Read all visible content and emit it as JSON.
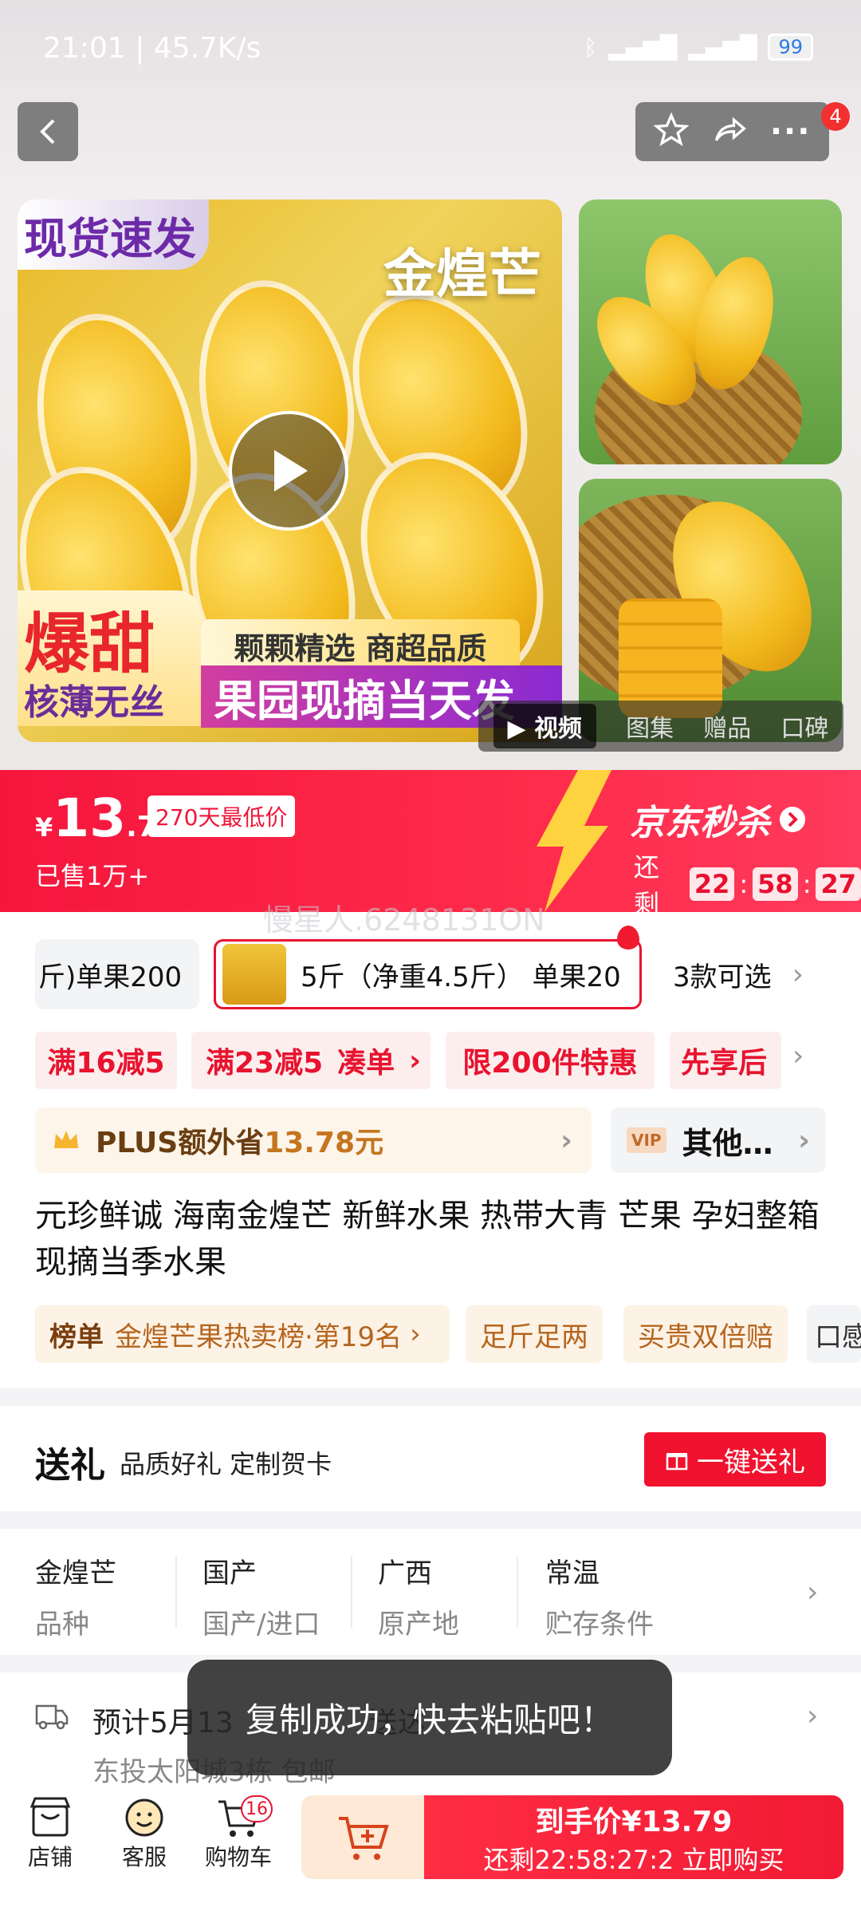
{
  "status_bar": {
    "time": "21:01 | 45.7K/s",
    "battery": "99"
  },
  "header": {
    "notification_count": "4"
  },
  "gallery": {
    "tag_top_left": "现货速发",
    "image_title": "金煌芒",
    "burst_title": "爆甜",
    "burst_sub": "核薄无丝",
    "select_bar": "颗颗精选 商超品质",
    "slogan": "果园现摘当天发",
    "media_tabs": [
      "视频",
      "图集",
      "赠品",
      "口碑"
    ]
  },
  "price": {
    "currency": "¥",
    "integer": "13",
    "decimal": ".79",
    "low_tag": "270天最低价",
    "sold": "已售1万+",
    "seckill": "京东秒杀",
    "countdown_label": "还剩",
    "hh": "22",
    "mm": "58",
    "ss": "27",
    "colors": {
      "band": "#f5163c"
    }
  },
  "watermark": "慢星人.6248131ON",
  "specs": {
    "left": "斤)单果200",
    "selected": "5斤（净重4.5斤） 单果20",
    "more": "3款可选"
  },
  "coupons": [
    "满16减5",
    "满23减5",
    "凑单",
    "限200件特惠",
    "先享后"
  ],
  "plus": {
    "label": "PLUS额外省",
    "amount": "13.78元"
  },
  "vip": {
    "icon": "VIP",
    "label": "其他…"
  },
  "product_title": "元珍鲜诚 海南金煌芒 新鲜水果 热带大青 芒果 孕妇整箱现摘当季水果",
  "tags": {
    "rank_label": "榜单",
    "rank_text": "金煌芒果热卖榜·第19名",
    "t2": "足斤足两",
    "t3": "买贵双倍赔",
    "t4": "口感"
  },
  "gift": {
    "title": "送礼",
    "subtitle": "品质好礼 定制贺卡",
    "button": "一键送礼"
  },
  "attributes": [
    {
      "value": "金煌芒",
      "key": "品种"
    },
    {
      "value": "国产",
      "key": "国产/进口"
    },
    {
      "value": "广西",
      "key": "原产地"
    },
    {
      "value": "常温",
      "key": "贮存条件"
    }
  ],
  "delivery": {
    "line1": "预计5月13",
    "line1_tail": "送达",
    "line2": "东投太阳城3栋  包邮"
  },
  "toast": "复制成功，快去粘贴吧！",
  "bottom": {
    "shop": "店铺",
    "service": "客服",
    "cart": "购物车",
    "cart_count": "16",
    "buy_line1": "到手价¥13.79",
    "buy_line2": "还剩22:58:27:2  立即购买"
  }
}
